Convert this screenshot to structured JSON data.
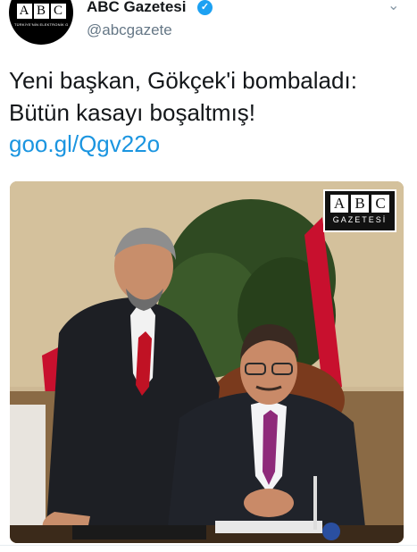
{
  "account": {
    "display_name": "ABC Gazetesi",
    "handle": "@abcgazete",
    "avatar_letters": [
      "A",
      "B",
      "C"
    ],
    "avatar_subtext": "TÜRKİYE'NİN ELEKTRONİK GAZETESİ"
  },
  "tweet": {
    "text": "Yeni başkan, Gökçek'i bombaladı: Bütün kasayı boşaltmış!",
    "link": "goo.gl/Qgv22o"
  },
  "photo": {
    "logo_letters": [
      "A",
      "B",
      "C"
    ],
    "logo_subtext": "GAZETESİ"
  },
  "icons": {
    "verified": "verified-badge-icon",
    "caret": "chevron-down-icon"
  },
  "colors": {
    "link": "#1b95e0",
    "verified": "#1da1f2",
    "handle": "#657786"
  }
}
